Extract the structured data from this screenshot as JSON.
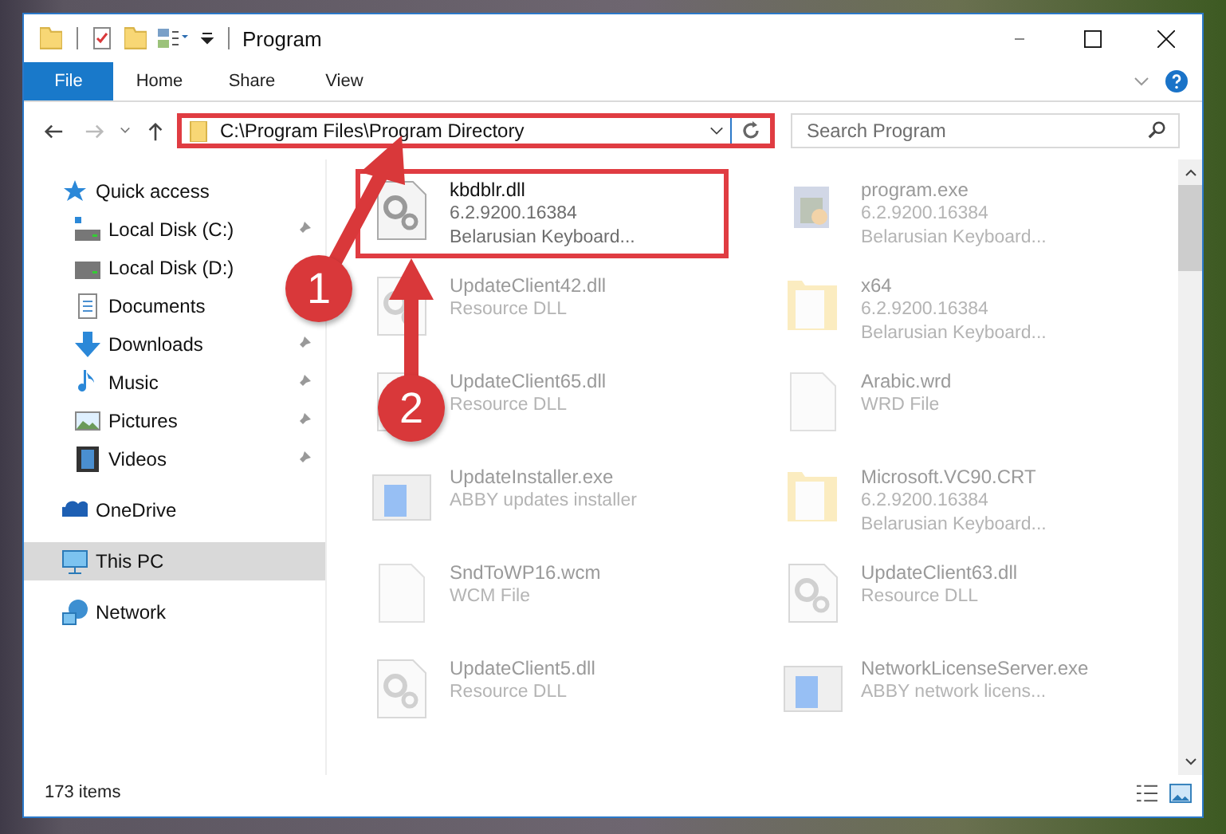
{
  "window": {
    "title": "Program"
  },
  "ribbon_tabs": [
    {
      "label": "File",
      "selected": true
    },
    {
      "label": "Home",
      "selected": false
    },
    {
      "label": "Share",
      "selected": false
    },
    {
      "label": "View",
      "selected": false
    }
  ],
  "address": {
    "path": "C:\\Program Files\\Program Directory",
    "highlighted": true
  },
  "search": {
    "placeholder": "Search Program"
  },
  "navigation": [
    {
      "label": "Quick access",
      "selected": false,
      "children": [
        {
          "label": "Local Disk (C:)",
          "pinned": true,
          "selected": false
        },
        {
          "label": "Local Disk (D:)",
          "pinned": false,
          "selected": false
        },
        {
          "label": "Documents",
          "pinned": false,
          "selected": false
        },
        {
          "label": "Downloads",
          "pinned": true,
          "selected": false
        },
        {
          "label": "Music",
          "pinned": true,
          "selected": false
        },
        {
          "label": "Pictures",
          "pinned": true,
          "selected": false
        },
        {
          "label": "Videos",
          "pinned": true,
          "selected": false
        }
      ]
    },
    {
      "label": "OneDrive",
      "selected": false
    },
    {
      "label": "This PC",
      "selected": true
    },
    {
      "label": "Network",
      "selected": false
    }
  ],
  "files": [
    {
      "name": "kbdblr.dll",
      "details": [
        "6.2.9200.16384",
        "Belarusian Keyboard..."
      ],
      "kind": "dll",
      "highlighted": true
    },
    {
      "name": "program.exe",
      "details": [
        "6.2.9200.16384",
        "Belarusian Keyboard..."
      ],
      "kind": "exe",
      "highlighted": false
    },
    {
      "name": "UpdateClient42.dll",
      "details": [
        "Resource DLL"
      ],
      "kind": "dll",
      "highlighted": false
    },
    {
      "name": "x64",
      "details": [
        "6.2.9200.16384",
        "Belarusian Keyboard..."
      ],
      "kind": "folder",
      "highlighted": false
    },
    {
      "name": "UpdateClient65.dll",
      "details": [
        "Resource DLL"
      ],
      "kind": "dll",
      "highlighted": false
    },
    {
      "name": "Arabic.wrd",
      "details": [
        "WRD File"
      ],
      "kind": "file",
      "highlighted": false
    },
    {
      "name": "UpdateInstaller.exe",
      "details": [
        "ABBY updates installer"
      ],
      "kind": "installer",
      "highlighted": false
    },
    {
      "name": "Microsoft.VC90.CRT",
      "details": [
        "6.2.9200.16384",
        "Belarusian Keyboard..."
      ],
      "kind": "folder",
      "highlighted": false
    },
    {
      "name": "SndToWP16.wcm",
      "details": [
        "WCM File"
      ],
      "kind": "file",
      "highlighted": false
    },
    {
      "name": "UpdateClient63.dll",
      "details": [
        "Resource DLL"
      ],
      "kind": "dll",
      "highlighted": false
    },
    {
      "name": "UpdateClient5.dll",
      "details": [
        "Resource DLL"
      ],
      "kind": "dll",
      "highlighted": false
    },
    {
      "name": "NetworkLicenseServer.exe",
      "details": [
        "ABBY network licens..."
      ],
      "kind": "installer",
      "highlighted": false
    }
  ],
  "status_bar": {
    "item_count": "173 items"
  },
  "callouts": [
    {
      "number": "1"
    },
    {
      "number": "2"
    }
  ]
}
